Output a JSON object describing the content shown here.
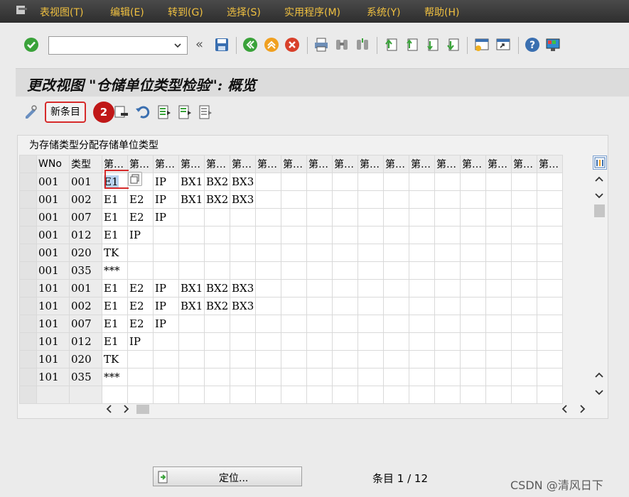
{
  "menu": [
    "表视图(T)",
    "编辑(E)",
    "转到(G)",
    "选择(S)",
    "实用程序(M)",
    "系统(Y)",
    "帮助(H)"
  ],
  "toolbar": {
    "command_value": "",
    "nav_label": "«"
  },
  "title": "更改视图 \"仓储单位类型检验\": 概览",
  "app_toolbar": {
    "new_entries": "新条目",
    "badge": "2"
  },
  "table": {
    "title": "为存储类型分配存储单位类型",
    "columns": [
      "WNo",
      "类型",
      "第…",
      "第…",
      "第…",
      "第…",
      "第…",
      "第…",
      "第…",
      "第…",
      "第…",
      "第…",
      "第…",
      "第…",
      "第…",
      "第…",
      "第…",
      "第…",
      "第…",
      "第…"
    ],
    "rows": [
      [
        "001",
        "001",
        "E1",
        "",
        "IP",
        "BX1",
        "BX2",
        "BX3"
      ],
      [
        "001",
        "002",
        "E1",
        "E2",
        "IP",
        "BX1",
        "BX2",
        "BX3"
      ],
      [
        "001",
        "007",
        "E1",
        "E2",
        "IP"
      ],
      [
        "001",
        "012",
        "E1",
        "IP"
      ],
      [
        "001",
        "020",
        "TK"
      ],
      [
        "001",
        "035",
        "***"
      ],
      [
        "101",
        "001",
        "E1",
        "E2",
        "IP",
        "BX1",
        "BX2",
        "BX3"
      ],
      [
        "101",
        "002",
        "E1",
        "E2",
        "IP",
        "BX1",
        "BX2",
        "BX3"
      ],
      [
        "101",
        "007",
        "E1",
        "E2",
        "IP"
      ],
      [
        "101",
        "012",
        "E1",
        "IP"
      ],
      [
        "101",
        "020",
        "TK"
      ],
      [
        "101",
        "035",
        "***"
      ],
      []
    ]
  },
  "footer": {
    "locate_label": "定位...",
    "entry_count": "条目 1 / 12",
    "watermark": "CSDN @清风日下"
  },
  "colors": {
    "menu_bg": "#3a3a3a",
    "menu_text": "#f0c040",
    "highlight_red": "#d62a2a",
    "selection_blue": "#b9d3ef"
  },
  "icons": [
    "sap-menu-icon",
    "check-icon",
    "save-icon",
    "back-icon",
    "exit-icon",
    "cancel-icon",
    "print-icon",
    "find-icon",
    "find-next-icon",
    "first-page-icon",
    "prev-page-icon",
    "next-page-icon",
    "last-page-icon",
    "new-session-icon",
    "shortcut-icon",
    "help-icon",
    "layout-icon",
    "edit-mode-icon",
    "delete-icon",
    "undo-icon",
    "select-all-icon",
    "select-block-icon",
    "deselect-all-icon",
    "column-settings-icon",
    "locate-icon"
  ]
}
